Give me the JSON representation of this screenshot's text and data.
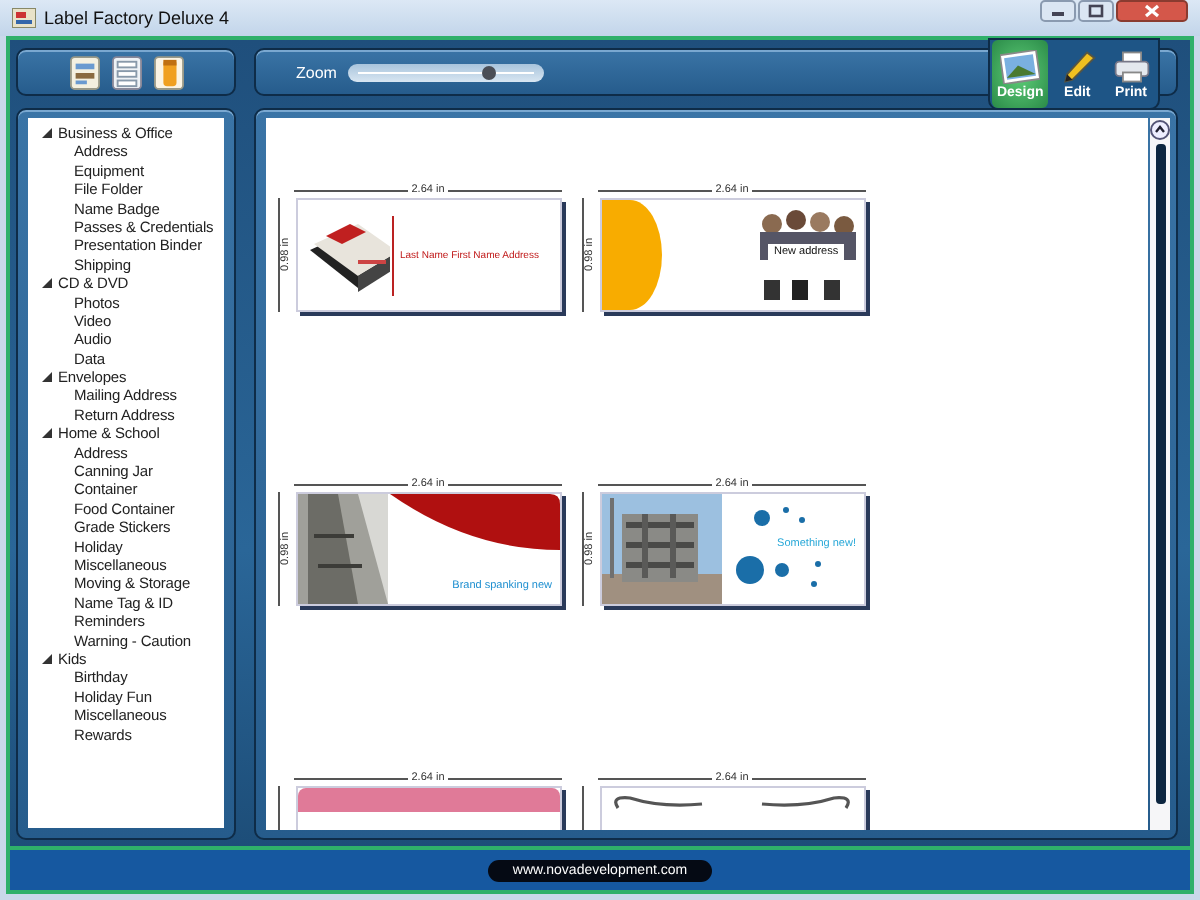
{
  "window": {
    "title": "Label Factory Deluxe 4"
  },
  "toolbar": {
    "tools": [
      {
        "kind": "labels"
      },
      {
        "kind": "sheets"
      },
      {
        "kind": "jar"
      }
    ],
    "zoom": {
      "label": "Zoom",
      "level": 0.72
    }
  },
  "modes": [
    {
      "label": "Design",
      "kind": "design",
      "selected": true
    },
    {
      "label": "Edit",
      "kind": "edit",
      "selected": false
    },
    {
      "label": "Print",
      "kind": "print",
      "selected": false
    }
  ],
  "tree": [
    {
      "label": "Business & Office",
      "expanded": true,
      "children": [
        {
          "label": "Address"
        },
        {
          "label": "Equipment"
        },
        {
          "label": "File Folder"
        },
        {
          "label": "Name Badge"
        },
        {
          "label": "Passes & Credentials"
        },
        {
          "label": "Presentation Binder"
        },
        {
          "label": "Shipping"
        }
      ]
    },
    {
      "label": "CD & DVD",
      "expanded": true,
      "children": [
        {
          "label": "Photos"
        },
        {
          "label": "Video"
        },
        {
          "label": "Audio"
        },
        {
          "label": "Data"
        }
      ]
    },
    {
      "label": "Envelopes",
      "expanded": true,
      "children": [
        {
          "label": "Mailing Address"
        },
        {
          "label": "Return Address"
        }
      ]
    },
    {
      "label": "Home & School",
      "expanded": true,
      "children": [
        {
          "label": "Address"
        },
        {
          "label": "Canning Jar"
        },
        {
          "label": "Container"
        },
        {
          "label": "Food Container"
        },
        {
          "label": "Grade Stickers"
        },
        {
          "label": "Holiday"
        },
        {
          "label": "Miscellaneous"
        },
        {
          "label": "Moving & Storage"
        },
        {
          "label": "Name Tag & ID"
        },
        {
          "label": "Reminders"
        },
        {
          "label": "Warning - Caution"
        }
      ]
    },
    {
      "label": "Kids",
      "expanded": true,
      "children": [
        {
          "label": "Birthday"
        },
        {
          "label": "Holiday Fun"
        },
        {
          "label": "Miscellaneous"
        },
        {
          "label": "Rewards"
        }
      ]
    }
  ],
  "labels": [
    {
      "kind": "stamp",
      "width": "2.64 in",
      "height": "0.98 in",
      "text": "Last Name First Name Address"
    },
    {
      "kind": "people",
      "width": "2.64 in",
      "height": "0.98 in",
      "text": "New address"
    },
    {
      "kind": "red-curve",
      "width": "2.64 in",
      "height": "0.98 in",
      "text": "Brand spanking new"
    },
    {
      "kind": "building",
      "width": "2.64 in",
      "height": "0.98 in",
      "text": "Something new!"
    },
    {
      "kind": "pink",
      "width": "2.64 in"
    },
    {
      "kind": "ornament",
      "width": "2.64 in"
    }
  ],
  "footer": {
    "url": "www.novadevelopment.com"
  }
}
